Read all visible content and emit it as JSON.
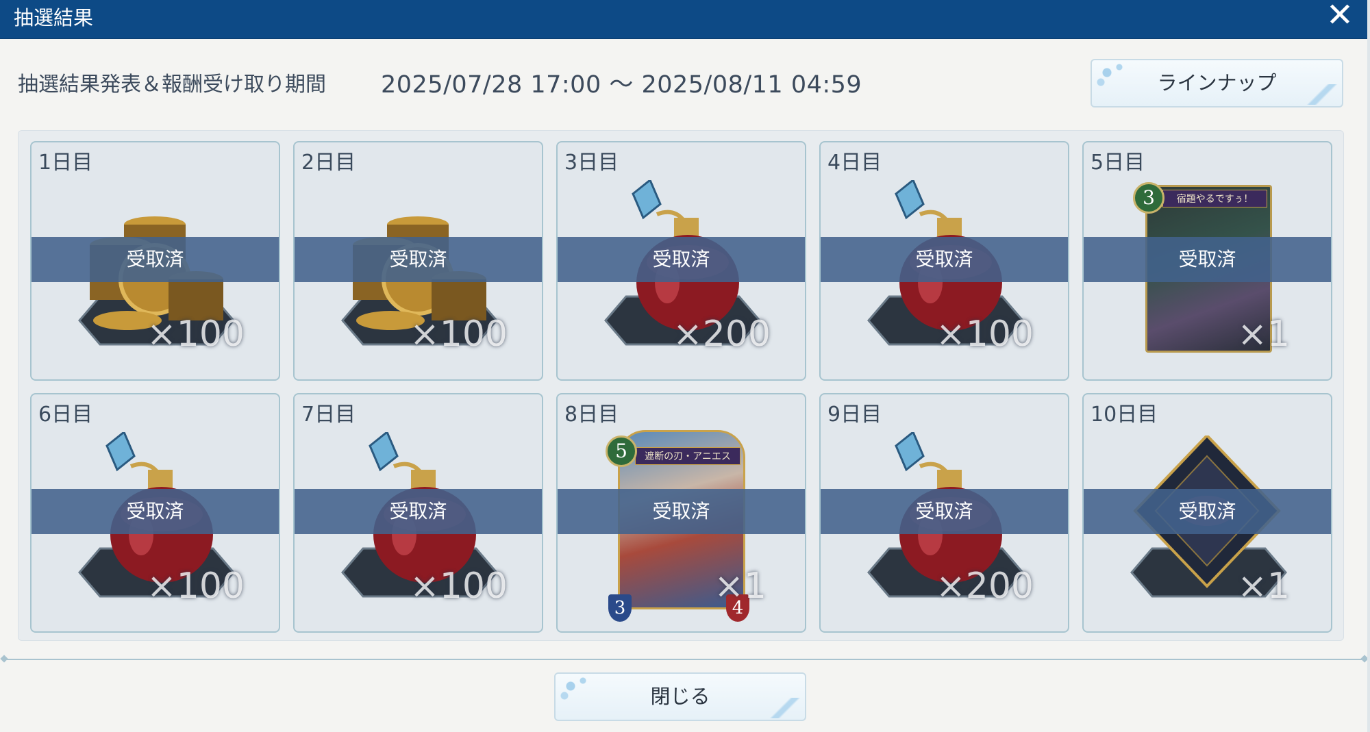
{
  "dialog": {
    "title": "抽選結果",
    "close_icon": "close-icon"
  },
  "period": {
    "label": "抽選結果発表＆報酬受け取り期間",
    "value": "2025/07/28 17:00 ～ 2025/08/11 04:59"
  },
  "buttons": {
    "lineup": "ラインナップ",
    "close": "閉じる"
  },
  "rewards": [
    {
      "day": "1日目",
      "status": "受取済",
      "qty": "×100",
      "icon": "coins-icon"
    },
    {
      "day": "2日目",
      "status": "受取済",
      "qty": "×100",
      "icon": "coins-icon"
    },
    {
      "day": "3日目",
      "status": "受取済",
      "qty": "×200",
      "icon": "potion-icon"
    },
    {
      "day": "4日目",
      "status": "受取済",
      "qty": "×100",
      "icon": "potion-icon"
    },
    {
      "day": "5日目",
      "status": "受取済",
      "qty": "×1",
      "icon": "card-icon",
      "card_name": "宿題やるですぅ！",
      "card_cost": "3"
    },
    {
      "day": "6日目",
      "status": "受取済",
      "qty": "×100",
      "icon": "potion-icon"
    },
    {
      "day": "7日目",
      "status": "受取済",
      "qty": "×100",
      "icon": "potion-icon"
    },
    {
      "day": "8日目",
      "status": "受取済",
      "qty": "×1",
      "icon": "card-icon",
      "card_name": "遮断の刃・アニエス",
      "card_cost": "5",
      "card_attack": "3",
      "card_defense": "4"
    },
    {
      "day": "9日目",
      "status": "受取済",
      "qty": "×200",
      "icon": "potion-icon"
    },
    {
      "day": "10日目",
      "status": "受取済",
      "qty": "×1",
      "icon": "amulet-icon"
    }
  ],
  "colors": {
    "titlebar": "#0d4a86",
    "received_band": "#42628c",
    "card_border": "#a7c4cf"
  }
}
